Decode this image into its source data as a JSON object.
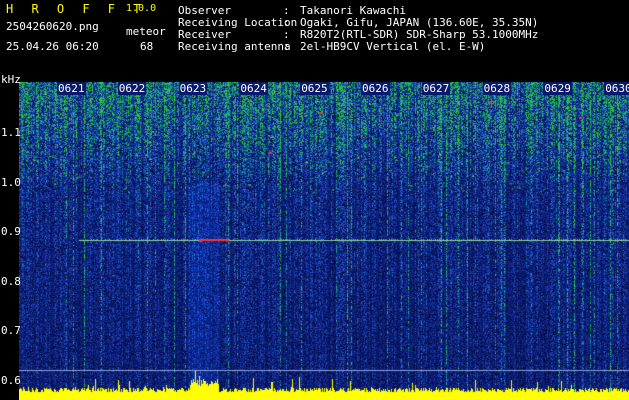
{
  "header": {
    "app_title": "H R O F F T",
    "version": "1.0.0",
    "filename": "2504260620.png",
    "datetime": "25.04.26 06:20",
    "meteor_label": "meteor",
    "meteor_count": "68"
  },
  "info": [
    {
      "key": "Observer",
      "sep": ":",
      "value": "Takanori Kawachi"
    },
    {
      "key": "Receiving Location",
      "sep": ":",
      "value": "Ogaki, Gifu, JAPAN (136.60E, 35.35N)"
    },
    {
      "key": "Receiver",
      "sep": ":",
      "value": "R820T2(RTL-SDR) SDR-Sharp 53.1000MHz"
    },
    {
      "key": "Receiving antenna",
      "sep": ":",
      "value": "2el-HB9CV Vertical (el. E-W)"
    }
  ],
  "chart_data": {
    "type": "heatmap",
    "ylabel": "kHz",
    "y_ticks": [
      "1.1",
      "1.0",
      "0.9",
      "0.8",
      "0.7",
      "0.6"
    ],
    "y_range": [
      0.6,
      1.14
    ],
    "x_ticks": [
      "0621",
      "0622",
      "0623",
      "0624",
      "0625",
      "0626",
      "0627",
      "0628",
      "0629",
      "0630"
    ],
    "x_range": [
      "06:20",
      "06:30"
    ],
    "carrier_khz": 0.88,
    "colors": {
      "background": "#0a1a6a",
      "signal": "#29d229",
      "peak": "#ff3030",
      "floor": "#ffff00",
      "labels": "#29d229"
    }
  }
}
